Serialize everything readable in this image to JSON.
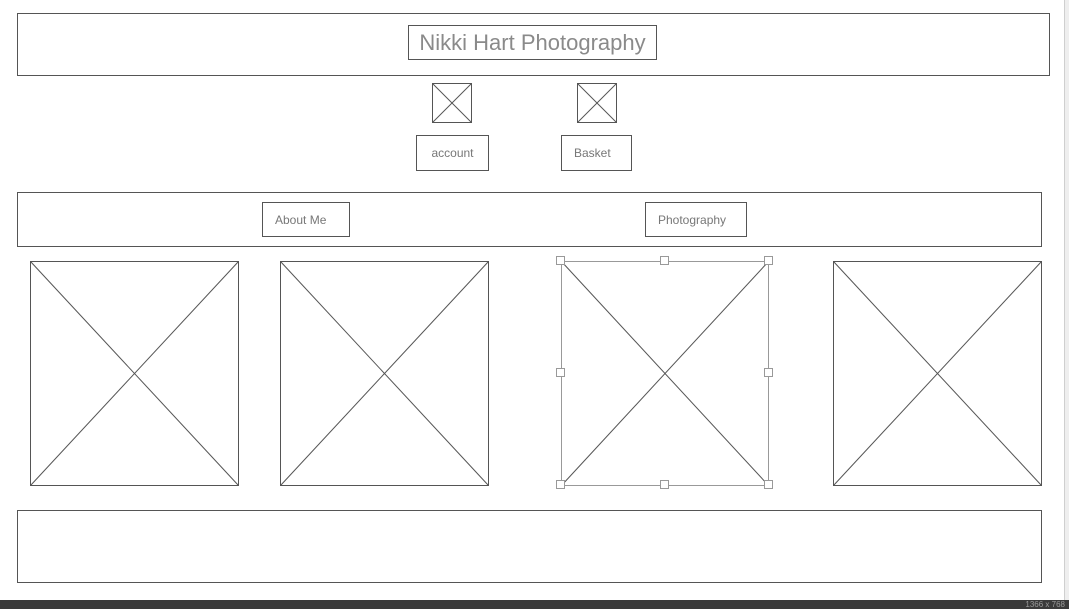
{
  "header": {
    "site_title": "Nikki Hart Photography"
  },
  "account": {
    "icon": "image-placeholder-icon",
    "label": "account"
  },
  "basket": {
    "icon": "image-placeholder-icon",
    "label": "Basket"
  },
  "nav": {
    "about_label": "About Me",
    "photography_label": "Photography"
  },
  "gallery": {
    "items": [
      {
        "icon": "image-placeholder-icon"
      },
      {
        "icon": "image-placeholder-icon"
      },
      {
        "icon": "image-placeholder-icon",
        "selected": true
      },
      {
        "icon": "image-placeholder-icon"
      }
    ]
  },
  "canvas": {
    "size_label": "1366 x 768"
  },
  "colors": {
    "stroke": "#555555",
    "selection": "#999999",
    "text": "#777777"
  }
}
